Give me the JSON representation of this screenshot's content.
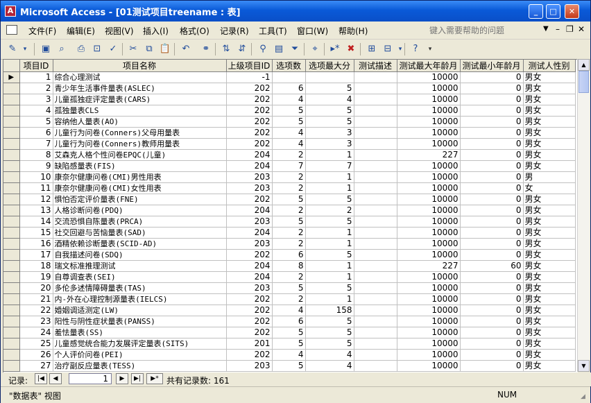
{
  "window": {
    "title": "Microsoft Access - [01测试项目treename : 表]"
  },
  "menu": {
    "items": [
      "文件(F)",
      "编辑(E)",
      "视图(V)",
      "插入(I)",
      "格式(O)",
      "记录(R)",
      "工具(T)",
      "窗口(W)",
      "帮助(H)"
    ],
    "help_placeholder": "键入需要帮助的问题"
  },
  "table": {
    "columns": [
      "项目ID",
      "项目名称",
      "上级项目ID",
      "选项数",
      "选项最大分",
      "测试描述",
      "测试最大年龄月",
      "测试最小年龄月",
      "测试人性别"
    ],
    "rows": [
      [
        "1",
        "综合心理测试",
        "-1",
        "",
        "",
        "",
        "10000",
        "0",
        "男女"
      ],
      [
        "2",
        "青少年生活事件量表(ASLEC)",
        "202",
        "6",
        "5",
        "",
        "10000",
        "0",
        "男女"
      ],
      [
        "3",
        "儿童孤独症评定量表(CARS)",
        "202",
        "4",
        "4",
        "",
        "10000",
        "0",
        "男女"
      ],
      [
        "4",
        "孤独量表CLS",
        "202",
        "5",
        "5",
        "",
        "10000",
        "0",
        "男女"
      ],
      [
        "5",
        "容纳他人量表(AO)",
        "202",
        "5",
        "5",
        "",
        "10000",
        "0",
        "男女"
      ],
      [
        "6",
        "儿童行为问卷(Conners)父母用量表",
        "202",
        "4",
        "3",
        "",
        "10000",
        "0",
        "男女"
      ],
      [
        "7",
        "儿童行为问卷(Conners)教师用量表",
        "202",
        "4",
        "3",
        "",
        "10000",
        "0",
        "男女"
      ],
      [
        "8",
        "艾森克人格个性问卷EPQC(儿童)",
        "204",
        "2",
        "1",
        "",
        "227",
        "0",
        "男女"
      ],
      [
        "9",
        "缺陷感量表(FIS)",
        "204",
        "7",
        "7",
        "",
        "10000",
        "0",
        "男女"
      ],
      [
        "10",
        "康奈尔健康问卷(CMI)男性用表",
        "203",
        "2",
        "1",
        "",
        "10000",
        "0",
        "男"
      ],
      [
        "11",
        "康奈尔健康问卷(CMI)女性用表",
        "203",
        "2",
        "1",
        "",
        "10000",
        "0",
        "女"
      ],
      [
        "12",
        "惧怕否定评价量表(FNE)",
        "202",
        "5",
        "5",
        "",
        "10000",
        "0",
        "男女"
      ],
      [
        "13",
        "人格诊断问卷(PDQ)",
        "204",
        "2",
        "2",
        "",
        "10000",
        "0",
        "男女"
      ],
      [
        "14",
        "交流恐惧自陈量表(PRCA)",
        "203",
        "5",
        "5",
        "",
        "10000",
        "0",
        "男女"
      ],
      [
        "15",
        "社交回避与苦恼量表(SAD)",
        "204",
        "2",
        "1",
        "",
        "10000",
        "0",
        "男女"
      ],
      [
        "16",
        "酒精依赖诊断量表(SCID-AD)",
        "203",
        "2",
        "1",
        "",
        "10000",
        "0",
        "男女"
      ],
      [
        "17",
        "自我描述问卷(SDQ)",
        "202",
        "6",
        "5",
        "",
        "10000",
        "0",
        "男女"
      ],
      [
        "18",
        "瑞文标准推理测试",
        "204",
        "8",
        "1",
        "",
        "227",
        "60",
        "男女"
      ],
      [
        "19",
        "自尊调查表(SEI)",
        "204",
        "2",
        "1",
        "",
        "10000",
        "0",
        "男女"
      ],
      [
        "20",
        "多伦多述情障碍量表(TAS)",
        "203",
        "5",
        "5",
        "",
        "10000",
        "0",
        "男女"
      ],
      [
        "21",
        "内-外在心理控制源量表(IELCS)",
        "202",
        "2",
        "1",
        "",
        "10000",
        "0",
        "男女"
      ],
      [
        "22",
        "婚姻调适测定(LW)",
        "202",
        "4",
        "158",
        "",
        "10000",
        "0",
        "男女"
      ],
      [
        "23",
        "阳性与阴性症状量表(PANSS)",
        "202",
        "6",
        "5",
        "",
        "10000",
        "0",
        "男女"
      ],
      [
        "24",
        "羞怯量表(SS)",
        "202",
        "5",
        "5",
        "",
        "10000",
        "0",
        "男女"
      ],
      [
        "25",
        "儿童感觉统合能力发展评定量表(SITS)",
        "201",
        "5",
        "5",
        "",
        "10000",
        "0",
        "男女"
      ],
      [
        "26",
        "个人评价问卷(PEI)",
        "202",
        "4",
        "4",
        "",
        "10000",
        "0",
        "男女"
      ],
      [
        "27",
        "治疗副反应量表(TESS)",
        "203",
        "5",
        "4",
        "",
        "10000",
        "0",
        "男女"
      ]
    ]
  },
  "navigator": {
    "label": "记录:",
    "current": "1",
    "count": "共有记录数: 161"
  },
  "status": {
    "view": "\"数据表\" 视图",
    "num": "NUM"
  },
  "colors": {
    "title_gradient": "#0a5ad8",
    "close": "#c2391a",
    "chrome": "#ece9d8"
  }
}
